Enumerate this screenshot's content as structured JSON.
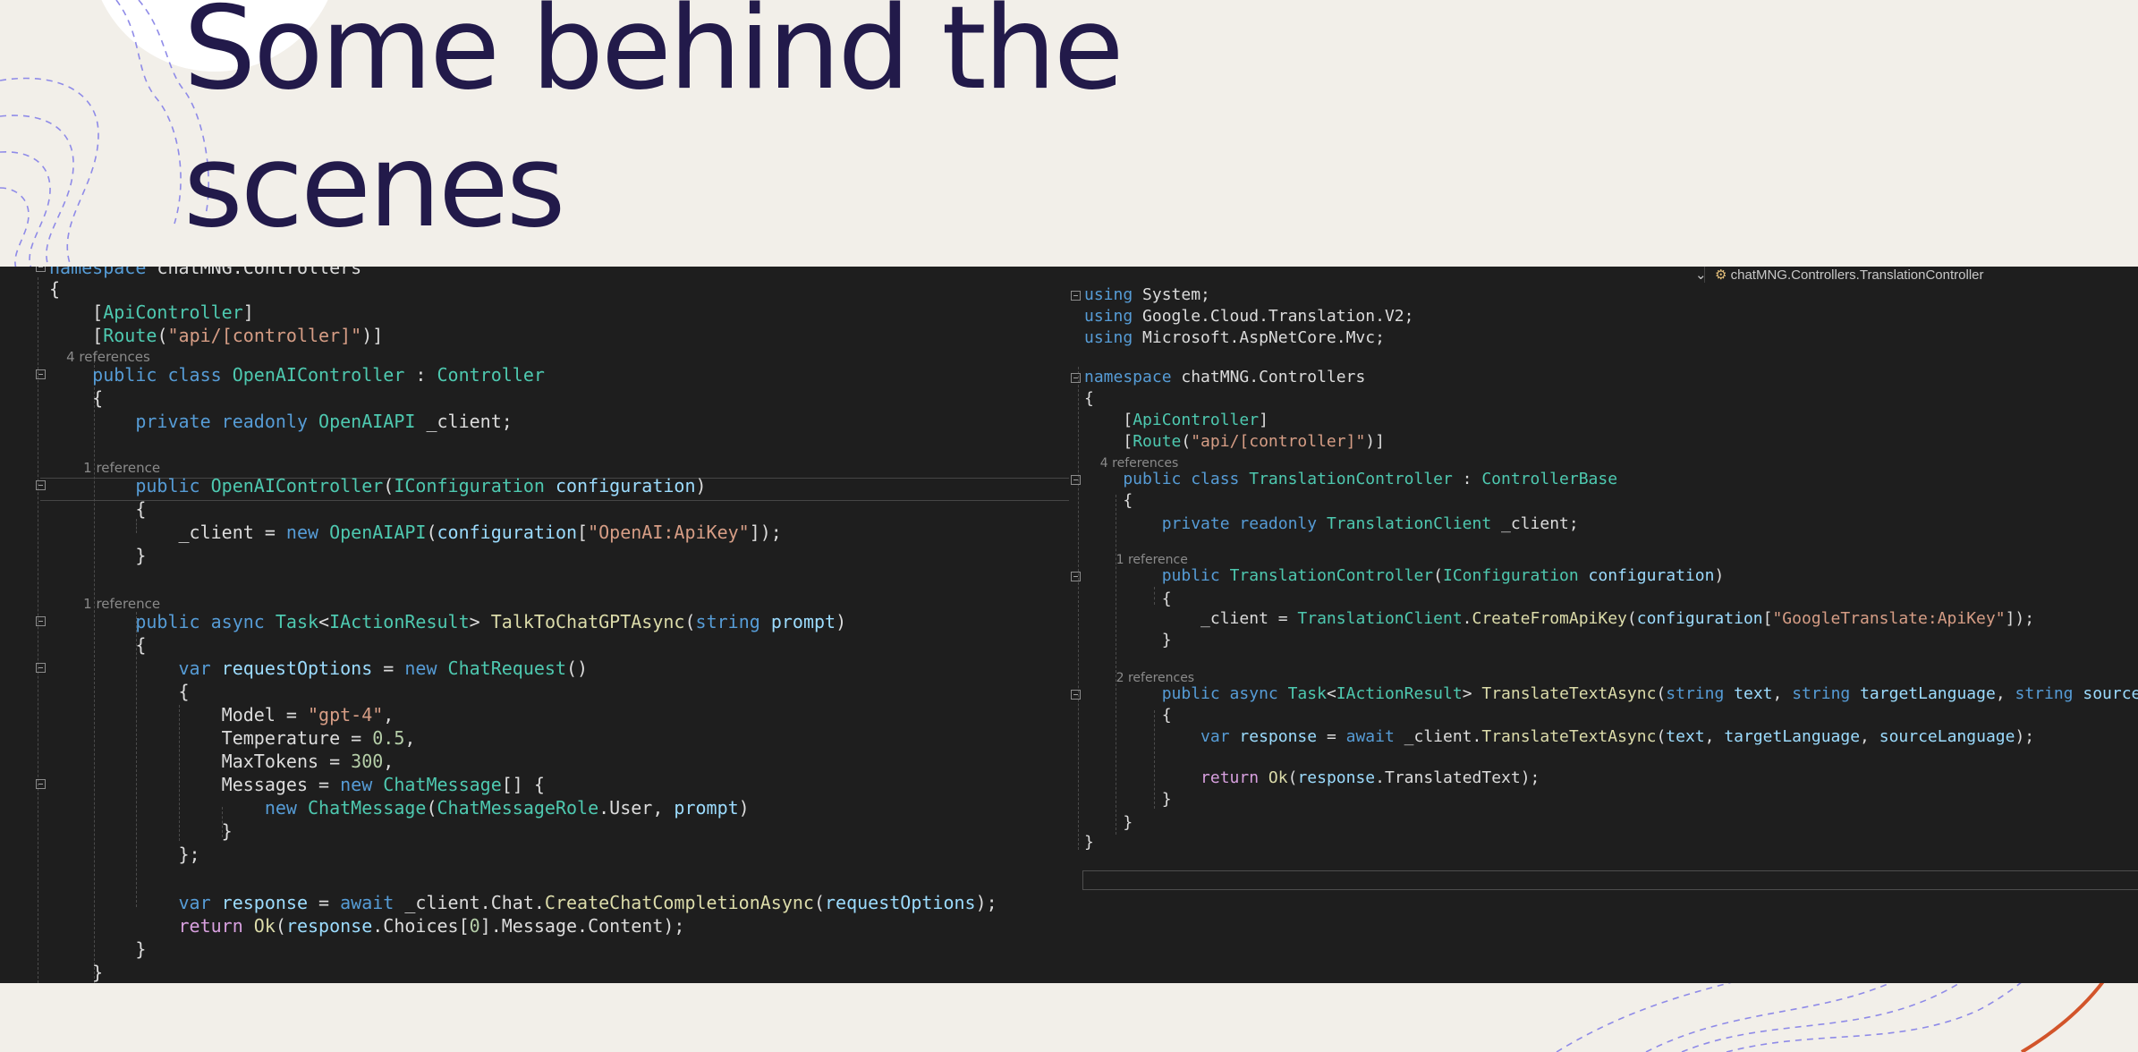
{
  "slide": {
    "title_line1": "Some behind the",
    "title_line2": "scenes"
  },
  "colors": {
    "background": "#f2efe9",
    "title": "#221a4a",
    "editor_bg": "#1e1e1e",
    "keyword": "#569cd6",
    "type": "#4ec9b0",
    "string": "#d69d85",
    "method": "#dcdcaa",
    "param": "#9cdcfe",
    "control": "#d8a0df",
    "number": "#b5cea8",
    "accent_curve": "#d2542a"
  },
  "left_editor": {
    "lines": [
      [
        {
          "t": "namespace",
          "c": "kw"
        },
        {
          "t": " chatMNG.Controllers",
          "c": "tx"
        }
      ],
      [
        {
          "t": "{",
          "c": "tx"
        }
      ],
      [
        {
          "t": "    [",
          "c": "tx"
        },
        {
          "t": "ApiController",
          "c": "ty"
        },
        {
          "t": "]",
          "c": "tx"
        }
      ],
      [
        {
          "t": "    [",
          "c": "tx"
        },
        {
          "t": "Route",
          "c": "ty"
        },
        {
          "t": "(",
          "c": "tx"
        },
        {
          "t": "\"api/[controller]\"",
          "c": "st"
        },
        {
          "t": ")]",
          "c": "tx"
        }
      ],
      [
        {
          "t": "    4 references",
          "c": "ln"
        }
      ],
      [
        {
          "t": "    public class",
          "c": "kw"
        },
        {
          "t": " ",
          "c": "tx"
        },
        {
          "t": "OpenAIController",
          "c": "ty"
        },
        {
          "t": " : ",
          "c": "tx"
        },
        {
          "t": "Controller",
          "c": "ty"
        }
      ],
      [
        {
          "t": "    {",
          "c": "tx"
        }
      ],
      [
        {
          "t": "        private readonly",
          "c": "kw"
        },
        {
          "t": " ",
          "c": "tx"
        },
        {
          "t": "OpenAIAPI",
          "c": "ty"
        },
        {
          "t": " _client;",
          "c": "tx"
        }
      ],
      [
        {
          "t": "",
          "c": "tx"
        }
      ],
      [
        {
          "t": "        1 reference",
          "c": "ln"
        }
      ],
      [
        {
          "t": "        public",
          "c": "kw"
        },
        {
          "t": " ",
          "c": "tx"
        },
        {
          "t": "OpenAIController",
          "c": "ty"
        },
        {
          "t": "(",
          "c": "tx"
        },
        {
          "t": "IConfiguration",
          "c": "ty"
        },
        {
          "t": " ",
          "c": "tx"
        },
        {
          "t": "configuration",
          "c": "pa"
        },
        {
          "t": ")",
          "c": "tx"
        }
      ],
      [
        {
          "t": "        {",
          "c": "tx"
        }
      ],
      [
        {
          "t": "            _client = ",
          "c": "tx"
        },
        {
          "t": "new",
          "c": "kw"
        },
        {
          "t": " ",
          "c": "tx"
        },
        {
          "t": "OpenAIAPI",
          "c": "ty"
        },
        {
          "t": "(",
          "c": "tx"
        },
        {
          "t": "configuration",
          "c": "pa"
        },
        {
          "t": "[",
          "c": "tx"
        },
        {
          "t": "\"OpenAI:ApiKey\"",
          "c": "st"
        },
        {
          "t": "]);",
          "c": "tx"
        }
      ],
      [
        {
          "t": "        }",
          "c": "tx"
        }
      ],
      [
        {
          "t": "",
          "c": "tx"
        }
      ],
      [
        {
          "t": "        1 reference",
          "c": "ln"
        }
      ],
      [
        {
          "t": "        public async",
          "c": "kw"
        },
        {
          "t": " ",
          "c": "tx"
        },
        {
          "t": "Task",
          "c": "ty"
        },
        {
          "t": "<",
          "c": "tx"
        },
        {
          "t": "IActionResult",
          "c": "ty"
        },
        {
          "t": "> ",
          "c": "tx"
        },
        {
          "t": "TalkToChatGPTAsync",
          "c": "me"
        },
        {
          "t": "(",
          "c": "tx"
        },
        {
          "t": "string",
          "c": "kw"
        },
        {
          "t": " ",
          "c": "tx"
        },
        {
          "t": "prompt",
          "c": "pa"
        },
        {
          "t": ")",
          "c": "tx"
        }
      ],
      [
        {
          "t": "        {",
          "c": "tx"
        }
      ],
      [
        {
          "t": "            var",
          "c": "kw"
        },
        {
          "t": " ",
          "c": "tx"
        },
        {
          "t": "requestOptions",
          "c": "pa"
        },
        {
          "t": " = ",
          "c": "tx"
        },
        {
          "t": "new",
          "c": "kw"
        },
        {
          "t": " ",
          "c": "tx"
        },
        {
          "t": "ChatRequest",
          "c": "ty"
        },
        {
          "t": "()",
          "c": "tx"
        }
      ],
      [
        {
          "t": "            {",
          "c": "tx"
        }
      ],
      [
        {
          "t": "                Model = ",
          "c": "tx"
        },
        {
          "t": "\"gpt-4\"",
          "c": "st"
        },
        {
          "t": ",",
          "c": "tx"
        }
      ],
      [
        {
          "t": "                Temperature = ",
          "c": "tx"
        },
        {
          "t": "0.5",
          "c": "nu"
        },
        {
          "t": ",",
          "c": "tx"
        }
      ],
      [
        {
          "t": "                MaxTokens = ",
          "c": "tx"
        },
        {
          "t": "300",
          "c": "nu"
        },
        {
          "t": ",",
          "c": "tx"
        }
      ],
      [
        {
          "t": "                Messages = ",
          "c": "tx"
        },
        {
          "t": "new",
          "c": "kw"
        },
        {
          "t": " ",
          "c": "tx"
        },
        {
          "t": "ChatMessage",
          "c": "ty"
        },
        {
          "t": "[] {",
          "c": "tx"
        }
      ],
      [
        {
          "t": "                    new",
          "c": "kw"
        },
        {
          "t": " ",
          "c": "tx"
        },
        {
          "t": "ChatMessage",
          "c": "ty"
        },
        {
          "t": "(",
          "c": "tx"
        },
        {
          "t": "ChatMessageRole",
          "c": "ty"
        },
        {
          "t": ".User, ",
          "c": "tx"
        },
        {
          "t": "prompt",
          "c": "pa"
        },
        {
          "t": ")",
          "c": "tx"
        }
      ],
      [
        {
          "t": "                }",
          "c": "tx"
        }
      ],
      [
        {
          "t": "            };",
          "c": "tx"
        }
      ],
      [
        {
          "t": "",
          "c": "tx"
        }
      ],
      [
        {
          "t": "            var",
          "c": "kw"
        },
        {
          "t": " ",
          "c": "tx"
        },
        {
          "t": "response",
          "c": "pa"
        },
        {
          "t": " = ",
          "c": "tx"
        },
        {
          "t": "await",
          "c": "kw"
        },
        {
          "t": " _client.Chat.",
          "c": "tx"
        },
        {
          "t": "CreateChatCompletionAsync",
          "c": "me"
        },
        {
          "t": "(",
          "c": "tx"
        },
        {
          "t": "requestOptions",
          "c": "pa"
        },
        {
          "t": ");",
          "c": "tx"
        }
      ],
      [
        {
          "t": "            return",
          "c": "ct"
        },
        {
          "t": " ",
          "c": "tx"
        },
        {
          "t": "Ok",
          "c": "me"
        },
        {
          "t": "(",
          "c": "tx"
        },
        {
          "t": "response",
          "c": "pa"
        },
        {
          "t": ".Choices[",
          "c": "tx"
        },
        {
          "t": "0",
          "c": "nu"
        },
        {
          "t": "].Message.Content);",
          "c": "tx"
        }
      ],
      [
        {
          "t": "        }",
          "c": "tx"
        }
      ],
      [
        {
          "t": "    }",
          "c": "tx"
        }
      ]
    ]
  },
  "right_editor": {
    "nav_text": "chatMNG.Controllers.TranslationController",
    "lines": [
      [
        {
          "t": "using",
          "c": "kw"
        },
        {
          "t": " System;",
          "c": "tx"
        }
      ],
      [
        {
          "t": "using",
          "c": "kw"
        },
        {
          "t": " Google.Cloud.Translation.V2;",
          "c": "tx"
        }
      ],
      [
        {
          "t": "using",
          "c": "kw"
        },
        {
          "t": " Microsoft.AspNetCore.Mvc;",
          "c": "tx"
        }
      ],
      [
        {
          "t": "",
          "c": "tx"
        }
      ],
      [
        {
          "t": "namespace",
          "c": "kw"
        },
        {
          "t": " chatMNG.Controllers",
          "c": "tx"
        }
      ],
      [
        {
          "t": "{",
          "c": "tx"
        }
      ],
      [
        {
          "t": "    [",
          "c": "tx"
        },
        {
          "t": "ApiController",
          "c": "ty"
        },
        {
          "t": "]",
          "c": "tx"
        }
      ],
      [
        {
          "t": "    [",
          "c": "tx"
        },
        {
          "t": "Route",
          "c": "ty"
        },
        {
          "t": "(",
          "c": "tx"
        },
        {
          "t": "\"api/[controller]\"",
          "c": "st"
        },
        {
          "t": ")]",
          "c": "tx"
        }
      ],
      [
        {
          "t": "    4 references",
          "c": "ln"
        }
      ],
      [
        {
          "t": "    public class",
          "c": "kw"
        },
        {
          "t": " ",
          "c": "tx"
        },
        {
          "t": "TranslationController",
          "c": "ty"
        },
        {
          "t": " : ",
          "c": "tx"
        },
        {
          "t": "ControllerBase",
          "c": "ty"
        }
      ],
      [
        {
          "t": "    {",
          "c": "tx"
        }
      ],
      [
        {
          "t": "        private readonly",
          "c": "kw"
        },
        {
          "t": " ",
          "c": "tx"
        },
        {
          "t": "TranslationClient",
          "c": "ty"
        },
        {
          "t": " _client;",
          "c": "tx"
        }
      ],
      [
        {
          "t": "",
          "c": "tx"
        }
      ],
      [
        {
          "t": "        1 reference",
          "c": "ln"
        }
      ],
      [
        {
          "t": "        public",
          "c": "kw"
        },
        {
          "t": " ",
          "c": "tx"
        },
        {
          "t": "TranslationController",
          "c": "ty"
        },
        {
          "t": "(",
          "c": "tx"
        },
        {
          "t": "IConfiguration",
          "c": "ty"
        },
        {
          "t": " ",
          "c": "tx"
        },
        {
          "t": "configuration",
          "c": "pa"
        },
        {
          "t": ")",
          "c": "tx"
        }
      ],
      [
        {
          "t": "        {",
          "c": "tx"
        }
      ],
      [
        {
          "t": "            _client = ",
          "c": "tx"
        },
        {
          "t": "TranslationClient",
          "c": "ty"
        },
        {
          "t": ".",
          "c": "tx"
        },
        {
          "t": "CreateFromApiKey",
          "c": "me"
        },
        {
          "t": "(",
          "c": "tx"
        },
        {
          "t": "configuration",
          "c": "pa"
        },
        {
          "t": "[",
          "c": "tx"
        },
        {
          "t": "\"GoogleTranslate:ApiKey\"",
          "c": "st"
        },
        {
          "t": "]);",
          "c": "tx"
        }
      ],
      [
        {
          "t": "        }",
          "c": "tx"
        }
      ],
      [
        {
          "t": "",
          "c": "tx"
        }
      ],
      [
        {
          "t": "        2 references",
          "c": "ln"
        }
      ],
      [
        {
          "t": "        public async",
          "c": "kw"
        },
        {
          "t": " ",
          "c": "tx"
        },
        {
          "t": "Task",
          "c": "ty"
        },
        {
          "t": "<",
          "c": "tx"
        },
        {
          "t": "IActionResult",
          "c": "ty"
        },
        {
          "t": "> ",
          "c": "tx"
        },
        {
          "t": "TranslateTextAsync",
          "c": "me"
        },
        {
          "t": "(",
          "c": "tx"
        },
        {
          "t": "string",
          "c": "kw"
        },
        {
          "t": " ",
          "c": "tx"
        },
        {
          "t": "text",
          "c": "pa"
        },
        {
          "t": ", ",
          "c": "tx"
        },
        {
          "t": "string",
          "c": "kw"
        },
        {
          "t": " ",
          "c": "tx"
        },
        {
          "t": "targetLanguage",
          "c": "pa"
        },
        {
          "t": ", ",
          "c": "tx"
        },
        {
          "t": "string",
          "c": "kw"
        },
        {
          "t": " ",
          "c": "tx"
        },
        {
          "t": "sourceLanguage",
          "c": "pa"
        },
        {
          "t": ")",
          "c": "tx"
        }
      ],
      [
        {
          "t": "        {",
          "c": "tx"
        }
      ],
      [
        {
          "t": "            var",
          "c": "kw"
        },
        {
          "t": " ",
          "c": "tx"
        },
        {
          "t": "response",
          "c": "pa"
        },
        {
          "t": " = ",
          "c": "tx"
        },
        {
          "t": "await",
          "c": "kw"
        },
        {
          "t": " _client.",
          "c": "tx"
        },
        {
          "t": "TranslateTextAsync",
          "c": "me"
        },
        {
          "t": "(",
          "c": "tx"
        },
        {
          "t": "text",
          "c": "pa"
        },
        {
          "t": ", ",
          "c": "tx"
        },
        {
          "t": "targetLanguage",
          "c": "pa"
        },
        {
          "t": ", ",
          "c": "tx"
        },
        {
          "t": "sourceLanguage",
          "c": "pa"
        },
        {
          "t": ");",
          "c": "tx"
        }
      ],
      [
        {
          "t": "",
          "c": "tx"
        }
      ],
      [
        {
          "t": "            return",
          "c": "ct"
        },
        {
          "t": " ",
          "c": "tx"
        },
        {
          "t": "Ok",
          "c": "me"
        },
        {
          "t": "(",
          "c": "tx"
        },
        {
          "t": "response",
          "c": "pa"
        },
        {
          "t": ".TranslatedText);",
          "c": "tx"
        }
      ],
      [
        {
          "t": "        }",
          "c": "tx"
        }
      ],
      [
        {
          "t": "    }",
          "c": "tx"
        }
      ],
      [
        {
          "t": "}",
          "c": "tx"
        }
      ]
    ]
  }
}
